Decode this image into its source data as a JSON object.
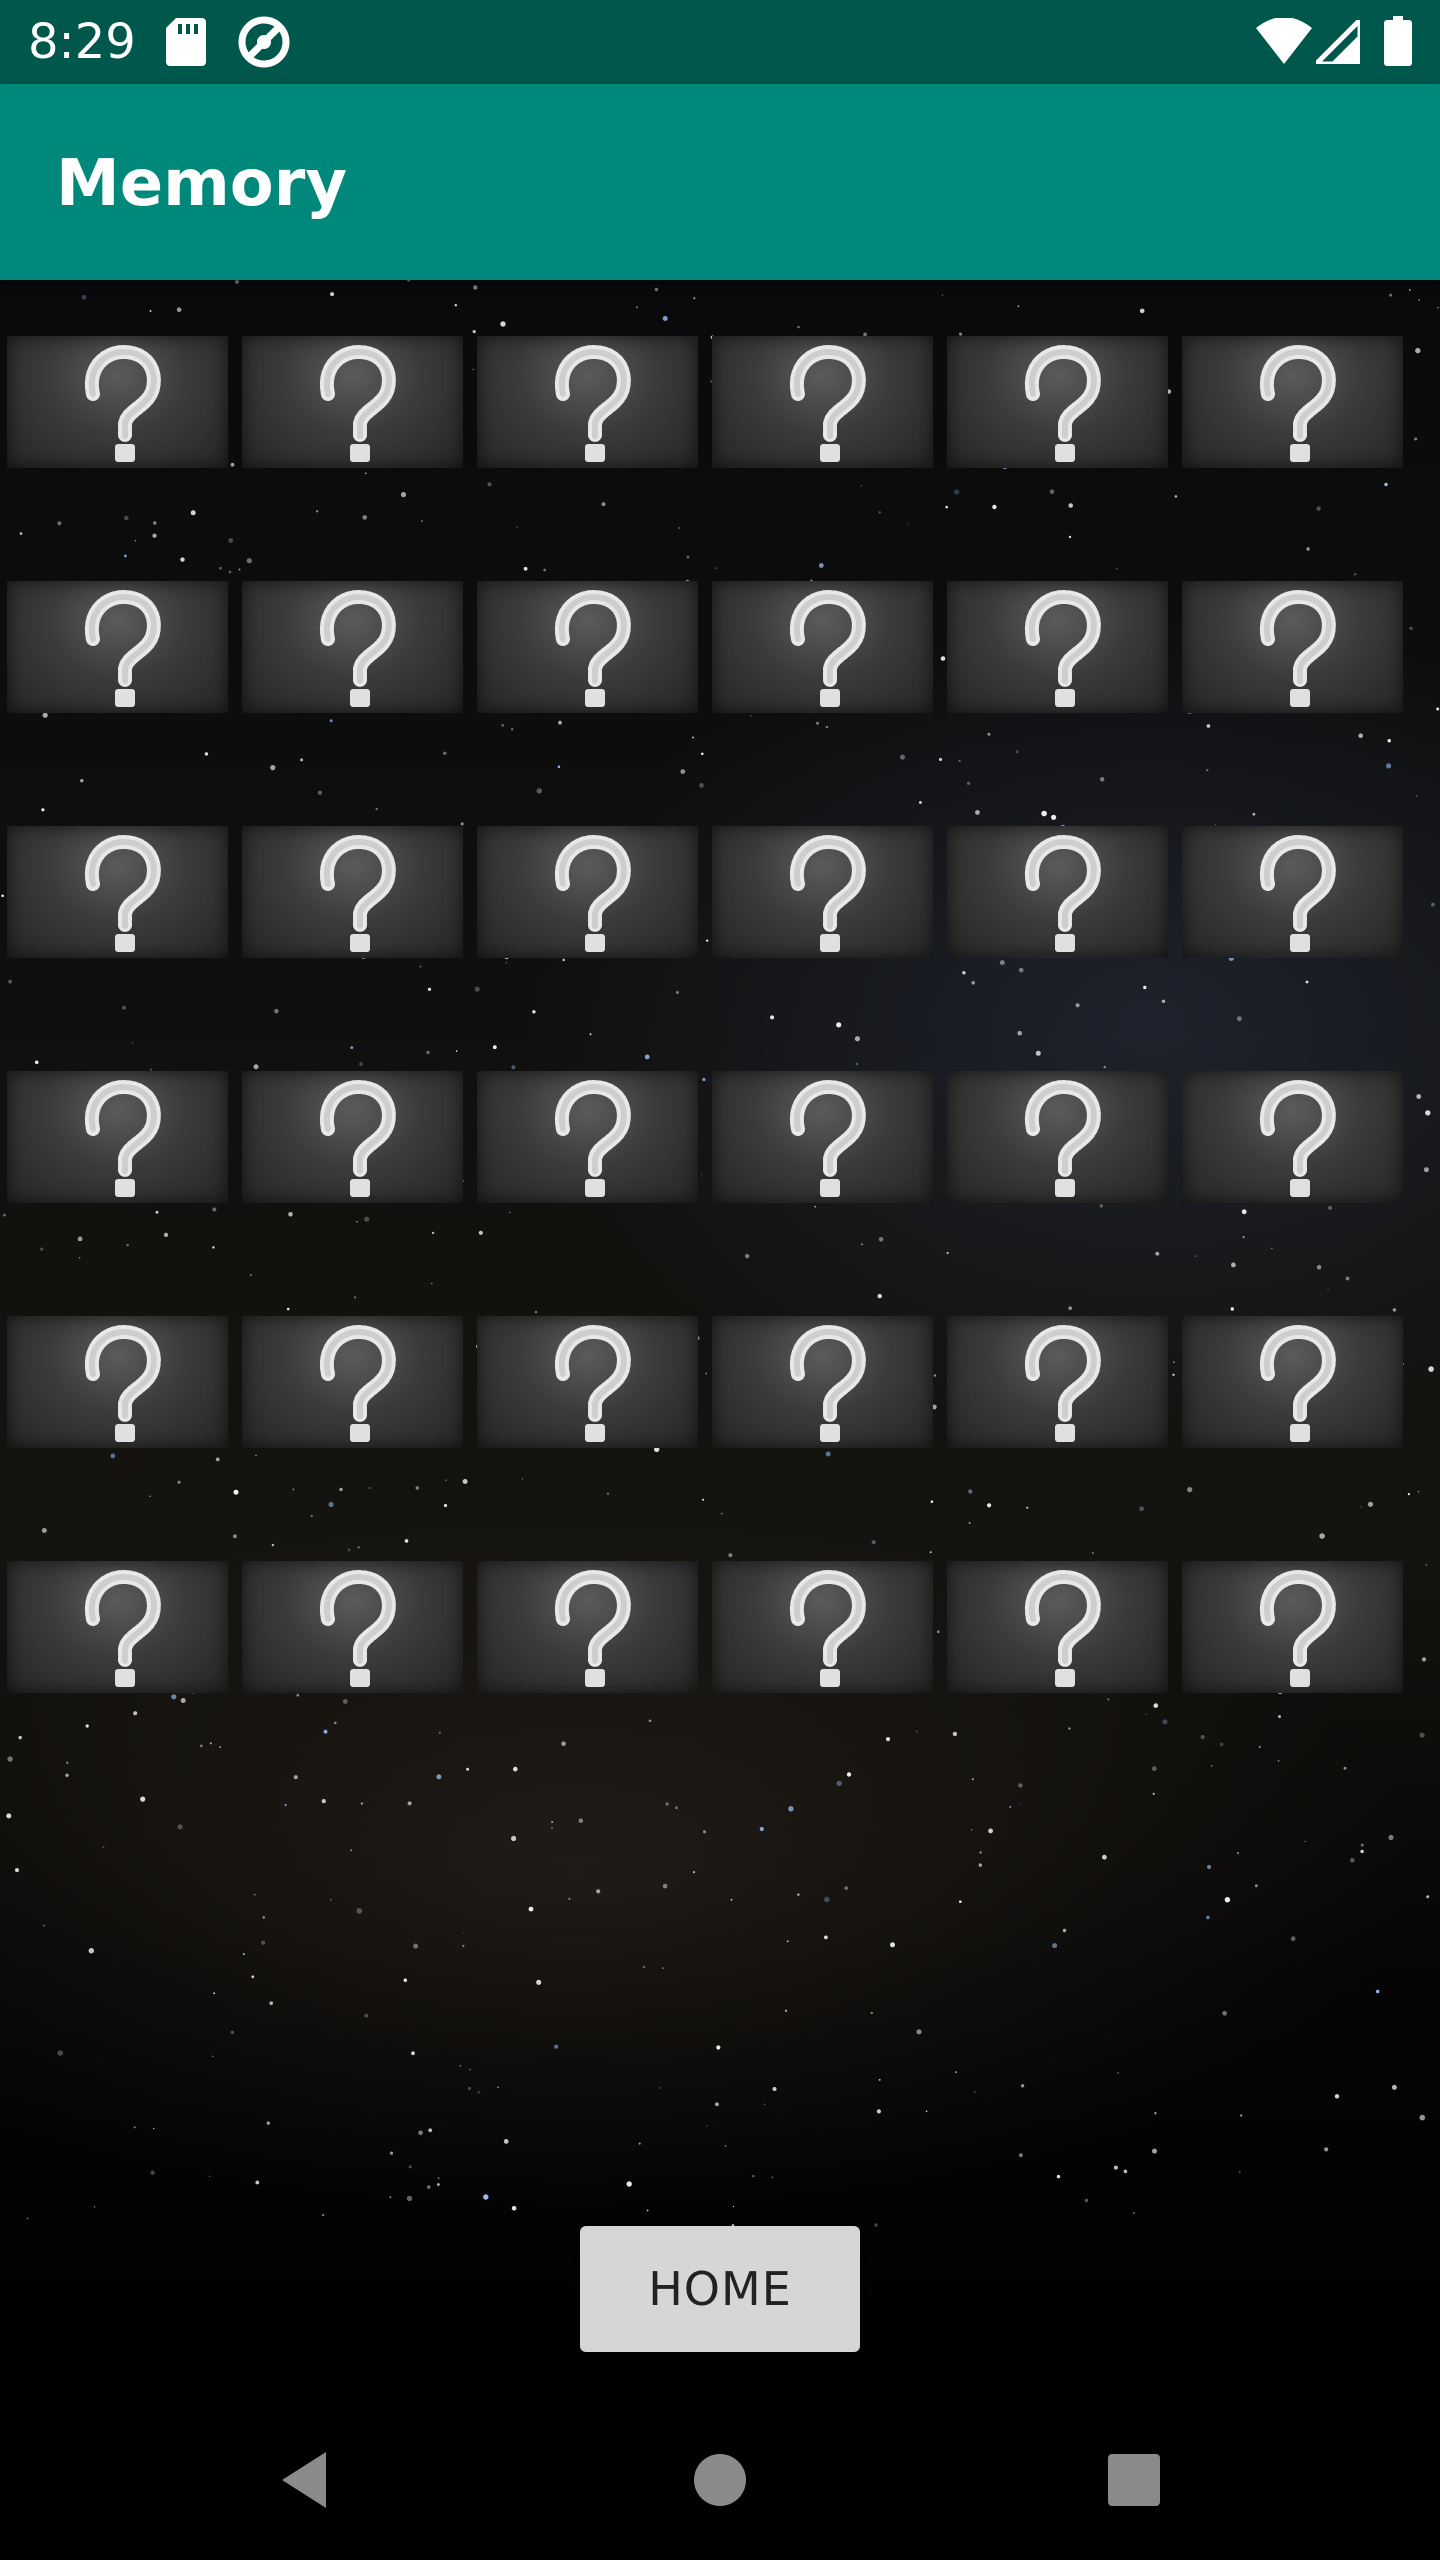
{
  "status_bar": {
    "time": "8:29",
    "icons": [
      "sd-card-icon",
      "sync-icon",
      "wifi-icon",
      "signal-icon",
      "battery-icon"
    ]
  },
  "app_bar": {
    "title": "Memory",
    "color": "#00897b",
    "status_color": "#00574b"
  },
  "game": {
    "rows": 6,
    "columns": 6,
    "card_face": "question-mark",
    "card_color": "#3a3a3a"
  },
  "home_button": {
    "label": "HOME"
  },
  "nav_bar": {
    "buttons": [
      "back-icon",
      "home-icon",
      "recents-icon"
    ]
  }
}
